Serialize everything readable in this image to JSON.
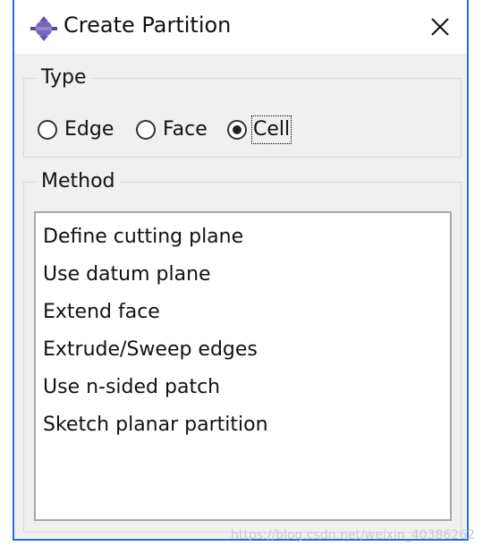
{
  "window": {
    "title": "Create Partition",
    "icon": "partition-tool-icon",
    "close_icon": "close-icon",
    "accent_color": "#1f74d1"
  },
  "type_group": {
    "legend": "Type",
    "options": [
      {
        "label": "Edge",
        "checked": false
      },
      {
        "label": "Face",
        "checked": false
      },
      {
        "label": "Cell",
        "checked": true
      }
    ]
  },
  "method_group": {
    "legend": "Method",
    "items": [
      "Define cutting plane",
      "Use datum plane",
      "Extend face",
      "Extrude/Sweep edges",
      "Use n-sided patch",
      "Sketch planar partition"
    ]
  },
  "watermark": "https://blog.csdn.net/weixin_40386262"
}
